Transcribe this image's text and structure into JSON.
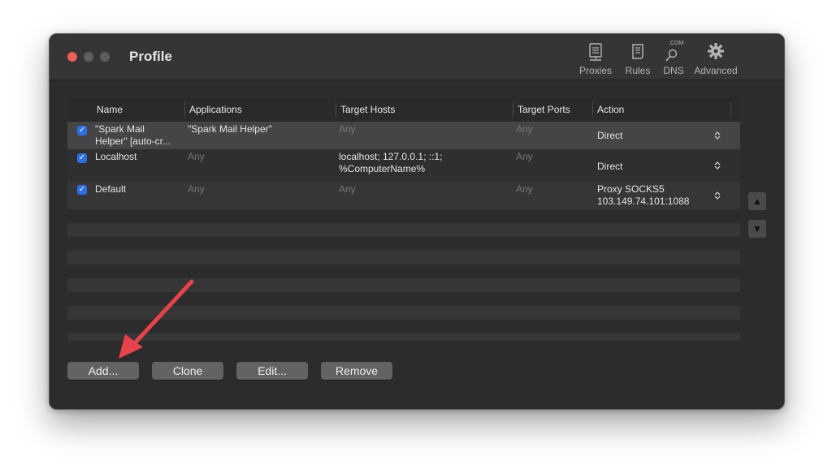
{
  "window": {
    "title": "Profile"
  },
  "toolbar": {
    "proxies": "Proxies",
    "rules": "Rules",
    "dns": "DNS",
    "dns_badge": ".COM",
    "advanced": "Advanced"
  },
  "table": {
    "headers": {
      "name": "Name",
      "applications": "Applications",
      "target_hosts": "Target Hosts",
      "target_ports": "Target Ports",
      "action": "Action"
    },
    "rows": [
      {
        "checked": true,
        "name_line1": "\"Spark Mail",
        "name_line2": "Helper\" [auto-cr...",
        "applications": "\"Spark Mail Helper\"",
        "target_hosts_line1": "Any",
        "target_hosts_line2": "",
        "target_ports": "Any",
        "action_line1": "Direct",
        "action_line2": ""
      },
      {
        "checked": true,
        "name_line1": "Localhost",
        "name_line2": "",
        "applications": "Any",
        "target_hosts_line1": "localhost; 127.0.0.1; ::1;",
        "target_hosts_line2": "%ComputerName%",
        "target_ports": "Any",
        "action_line1": "Direct",
        "action_line2": ""
      },
      {
        "checked": true,
        "name_line1": "Default",
        "name_line2": "",
        "applications": "Any",
        "target_hosts_line1": "Any",
        "target_hosts_line2": "",
        "target_ports": "Any",
        "action_line1": "Proxy SOCKS5",
        "action_line2": "103.149.74.101:1088"
      }
    ]
  },
  "buttons": {
    "add": "Add...",
    "clone": "Clone",
    "edit": "Edit...",
    "remove": "Remove"
  },
  "icons": {
    "checkbox": "✓",
    "popup": "⌃⌄",
    "move_up": "▲",
    "move_down": "▼"
  },
  "colors": {
    "close_button": "#ec5e57",
    "checkbox_accent": "#2d6de6",
    "annotation_arrow": "#e8434b"
  }
}
